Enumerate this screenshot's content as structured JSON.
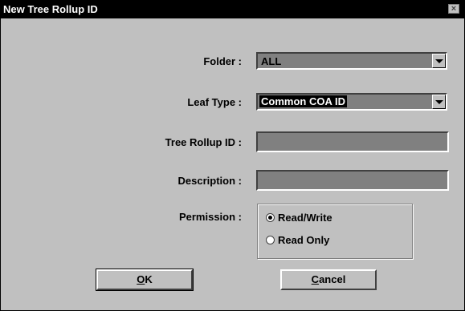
{
  "dialog": {
    "title": "New Tree Rollup ID",
    "close_glyph": "×"
  },
  "form": {
    "folder_label": "Folder :",
    "folder_value": "ALL",
    "leaf_type_label": "Leaf Type :",
    "leaf_type_value": "Common COA ID",
    "tree_rollup_label": "Tree Rollup ID :",
    "tree_rollup_value": "",
    "description_label": "Description :",
    "description_value": "",
    "permission_label": "Permission :",
    "permission_options": [
      {
        "label": "Read/Write",
        "selected": true
      },
      {
        "label": "Read Only",
        "selected": false
      }
    ]
  },
  "buttons": {
    "ok_mnemonic": "O",
    "ok_rest": "K",
    "cancel_mnemonic": "C",
    "cancel_rest": "ancel"
  },
  "icons": {
    "dropdown": "chevron-down-icon",
    "close": "close-icon"
  },
  "colors": {
    "dialog_bg": "#c0c0c0",
    "field_bg": "#808080",
    "titlebar_bg": "#000000",
    "titlebar_text": "#ffffff"
  }
}
